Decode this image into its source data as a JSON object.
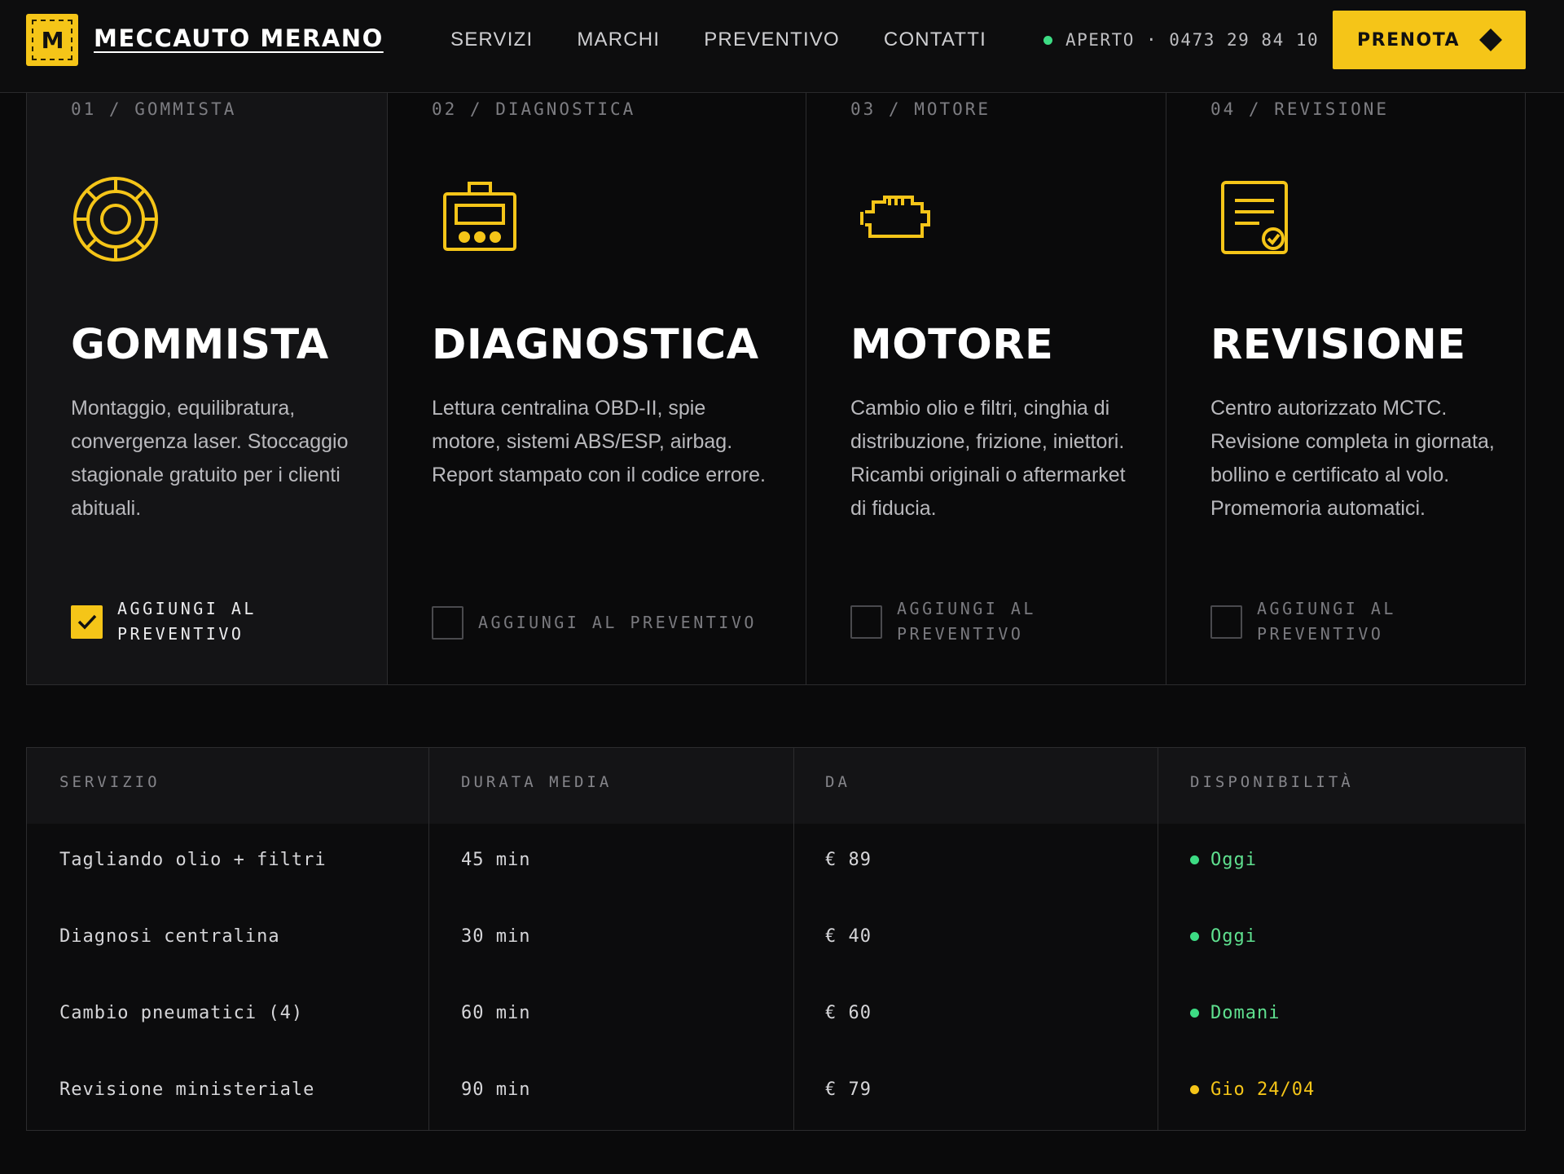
{
  "header": {
    "logo_letter": "M",
    "brand": "MECCAUTO MERANO",
    "nav": [
      "SERVIZI",
      "MARCHI",
      "PREVENTIVO",
      "CONTATTI"
    ],
    "status": "APERTO · 0473 29 84 10",
    "cta": "PRENOTA"
  },
  "colors": {
    "accent": "#f5c518",
    "status_open": "#3ddc84",
    "warning": "#f5c518"
  },
  "services": [
    {
      "num": "01 / GOMMISTA",
      "icon": "tire-icon",
      "title": "GOMMISTA",
      "desc": "Montaggio, equilibratura, convergenza laser. Stoccaggio stagionale gratuito per i clienti abituali.",
      "add_label": "AGGIUNGI AL PREVENTIVO",
      "checked": true
    },
    {
      "num": "02 / DIAGNOSTICA",
      "icon": "diagnostic-device-icon",
      "title": "DIAGNOSTICA",
      "desc": "Lettura centralina OBD-II, spie motore, sistemi ABS/ESP, airbag. Report stampato con il codice errore.",
      "add_label": "AGGIUNGI AL PREVENTIVO",
      "checked": false
    },
    {
      "num": "03 / MOTORE",
      "icon": "engine-icon",
      "title": "MOTORE",
      "desc": "Cambio olio e filtri, cinghia di distribuzione, frizione, iniettori. Ricambi originali o aftermarket di fiducia.",
      "add_label": "AGGIUNGI AL PREVENTIVO",
      "checked": false
    },
    {
      "num": "04 / REVISIONE",
      "icon": "certificate-icon",
      "title": "REVISIONE",
      "desc": "Centro autorizzato MCTC. Revisione completa in giornata, bollino e certificato al volo. Promemoria automatici.",
      "add_label": "AGGIUNGI AL PREVENTIVO",
      "checked": false
    }
  ],
  "table": {
    "headers": [
      "SERVIZIO",
      "DURATA MEDIA",
      "DA",
      "DISPONIBILITÀ"
    ],
    "rows": [
      {
        "service": "Tagliando olio + filtri",
        "duration": "45 min",
        "price": "€ 89",
        "availability": "Oggi",
        "status": "green"
      },
      {
        "service": "Diagnosi centralina",
        "duration": "30 min",
        "price": "€ 40",
        "availability": "Oggi",
        "status": "green"
      },
      {
        "service": "Cambio pneumatici (4)",
        "duration": "60 min",
        "price": "€ 60",
        "availability": "Domani",
        "status": "green"
      },
      {
        "service": "Revisione ministeriale",
        "duration": "90 min",
        "price": "€ 79",
        "availability": "Gio 24/04",
        "status": "yellow"
      }
    ]
  }
}
